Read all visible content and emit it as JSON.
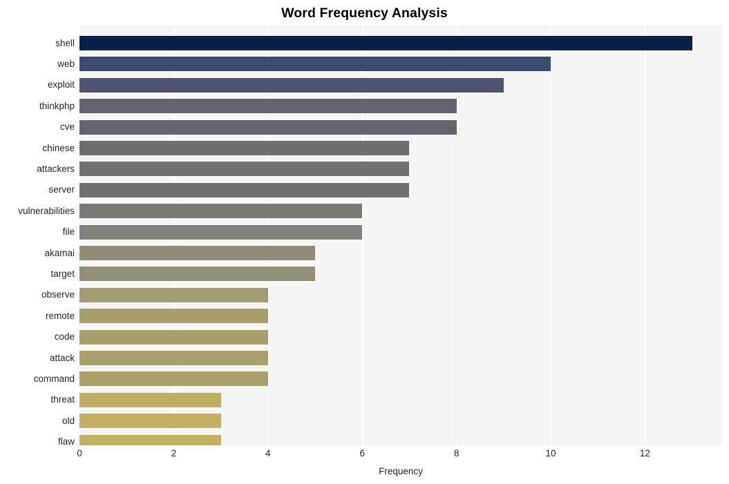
{
  "chart_data": {
    "type": "bar",
    "orientation": "horizontal",
    "title": "Word Frequency Analysis",
    "xlabel": "Frequency",
    "ylabel": "",
    "xlim": [
      0,
      13.65
    ],
    "xticks": [
      0,
      2,
      4,
      6,
      8,
      10,
      12
    ],
    "xtick_labels": [
      "0",
      "2",
      "4",
      "6",
      "8",
      "10",
      "12"
    ],
    "grid": "vertical",
    "legend": null,
    "categories": [
      "shell",
      "web",
      "exploit",
      "thinkphp",
      "cve",
      "chinese",
      "attackers",
      "server",
      "vulnerabilities",
      "file",
      "akamai",
      "target",
      "observe",
      "remote",
      "code",
      "attack",
      "command",
      "threat",
      "old",
      "flaw"
    ],
    "values": [
      13,
      10,
      9,
      8,
      8,
      7,
      7,
      7,
      6,
      6,
      5,
      5,
      4,
      4,
      4,
      4,
      4,
      3,
      3,
      3
    ],
    "bar_colors": [
      "#0a2147",
      "#3d4b6e",
      "#4f5470",
      "#626271",
      "#646470",
      "#6e6e70",
      "#717171",
      "#717171",
      "#7a7a74",
      "#82817a",
      "#8e8c76",
      "#928f77",
      "#a49c6f",
      "#a89f6c",
      "#a89f6c",
      "#a9a06b",
      "#aaa16a",
      "#c0ad62",
      "#c2af61",
      "#c3b160"
    ]
  },
  "figure": {
    "background": "#ffffff",
    "plot_background": "#f5f5f6",
    "gridline_color": "#ffffff",
    "text_color": "#262626",
    "title_color": "#000000"
  }
}
